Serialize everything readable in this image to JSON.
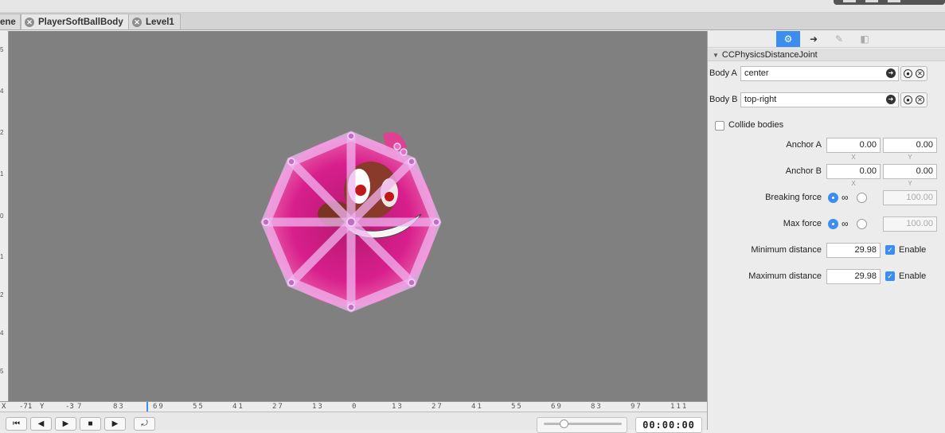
{
  "tabs": [
    {
      "label": "ene",
      "closable": false
    },
    {
      "label": "PlayerSoftBallBody",
      "closable": true
    },
    {
      "label": "Level1",
      "closable": true
    }
  ],
  "tab_close_glyph": "✕",
  "ruler": {
    "x_label": "X",
    "x_value": "-71",
    "y_label": "Y",
    "y_value": "-3",
    "h_ticks": [
      "7",
      "83",
      "69",
      "55",
      "41",
      "27",
      "13",
      "0",
      "13",
      "27",
      "41",
      "55",
      "69",
      "83",
      "97",
      "111"
    ],
    "v_ticks": [
      "5",
      "4",
      "2",
      "1",
      "0",
      "1",
      "2",
      "4",
      "5"
    ]
  },
  "playback": {
    "buttons": [
      {
        "name": "jump-to-start-button",
        "icon": "skip-back-icon",
        "glyph": "⏮"
      },
      {
        "name": "step-back-button",
        "icon": "step-back-icon",
        "glyph": "◀"
      },
      {
        "name": "step-forward-button",
        "icon": "step-forward-icon",
        "glyph": "▶"
      },
      {
        "name": "stop-button",
        "icon": "stop-icon",
        "glyph": "■"
      },
      {
        "name": "play-button",
        "icon": "play-icon",
        "glyph": "▶"
      },
      {
        "name": "loop-button",
        "icon": "loop-icon",
        "glyph": "⤾"
      }
    ],
    "timecode": "00:00:00",
    "zoom_fraction": 0.25
  },
  "inspector": {
    "tab_icons": [
      "physics-icon",
      "arrow-right-icon",
      "brush-icon",
      "layers-icon"
    ],
    "tab_glyphs": [
      "⚙",
      "➜",
      "✎",
      "◧"
    ],
    "section_title": "CCPhysicsDistanceJoint",
    "body_a": {
      "label": "Body A",
      "value": "center"
    },
    "body_b": {
      "label": "Body B",
      "value": "top-right"
    },
    "collide_bodies": {
      "label": "Collide bodies",
      "checked": false
    },
    "anchor_a": {
      "label": "Anchor A",
      "x": "0.00",
      "y": "0.00",
      "x_sub": "X",
      "y_sub": "Y"
    },
    "anchor_b": {
      "label": "Anchor B",
      "x": "0.00",
      "y": "0.00",
      "x_sub": "X",
      "y_sub": "Y"
    },
    "breaking_force": {
      "label": "Breaking force",
      "infinity": "∞",
      "value": "100.00",
      "selected": "infinite"
    },
    "max_force": {
      "label": "Max force",
      "infinity": "∞",
      "value": "100.00",
      "selected": "infinite"
    },
    "min_distance": {
      "label": "Minimum distance",
      "value": "29.98",
      "enable_label": "Enable",
      "enabled": true
    },
    "max_distance": {
      "label": "Maximum distance",
      "value": "29.98",
      "enable_label": "Enable",
      "enabled": true
    }
  },
  "colors": {
    "accent": "#3b8ef0",
    "canvas": "#808080",
    "joint": "#e6a0e6",
    "sprite": "#d81f8c"
  }
}
